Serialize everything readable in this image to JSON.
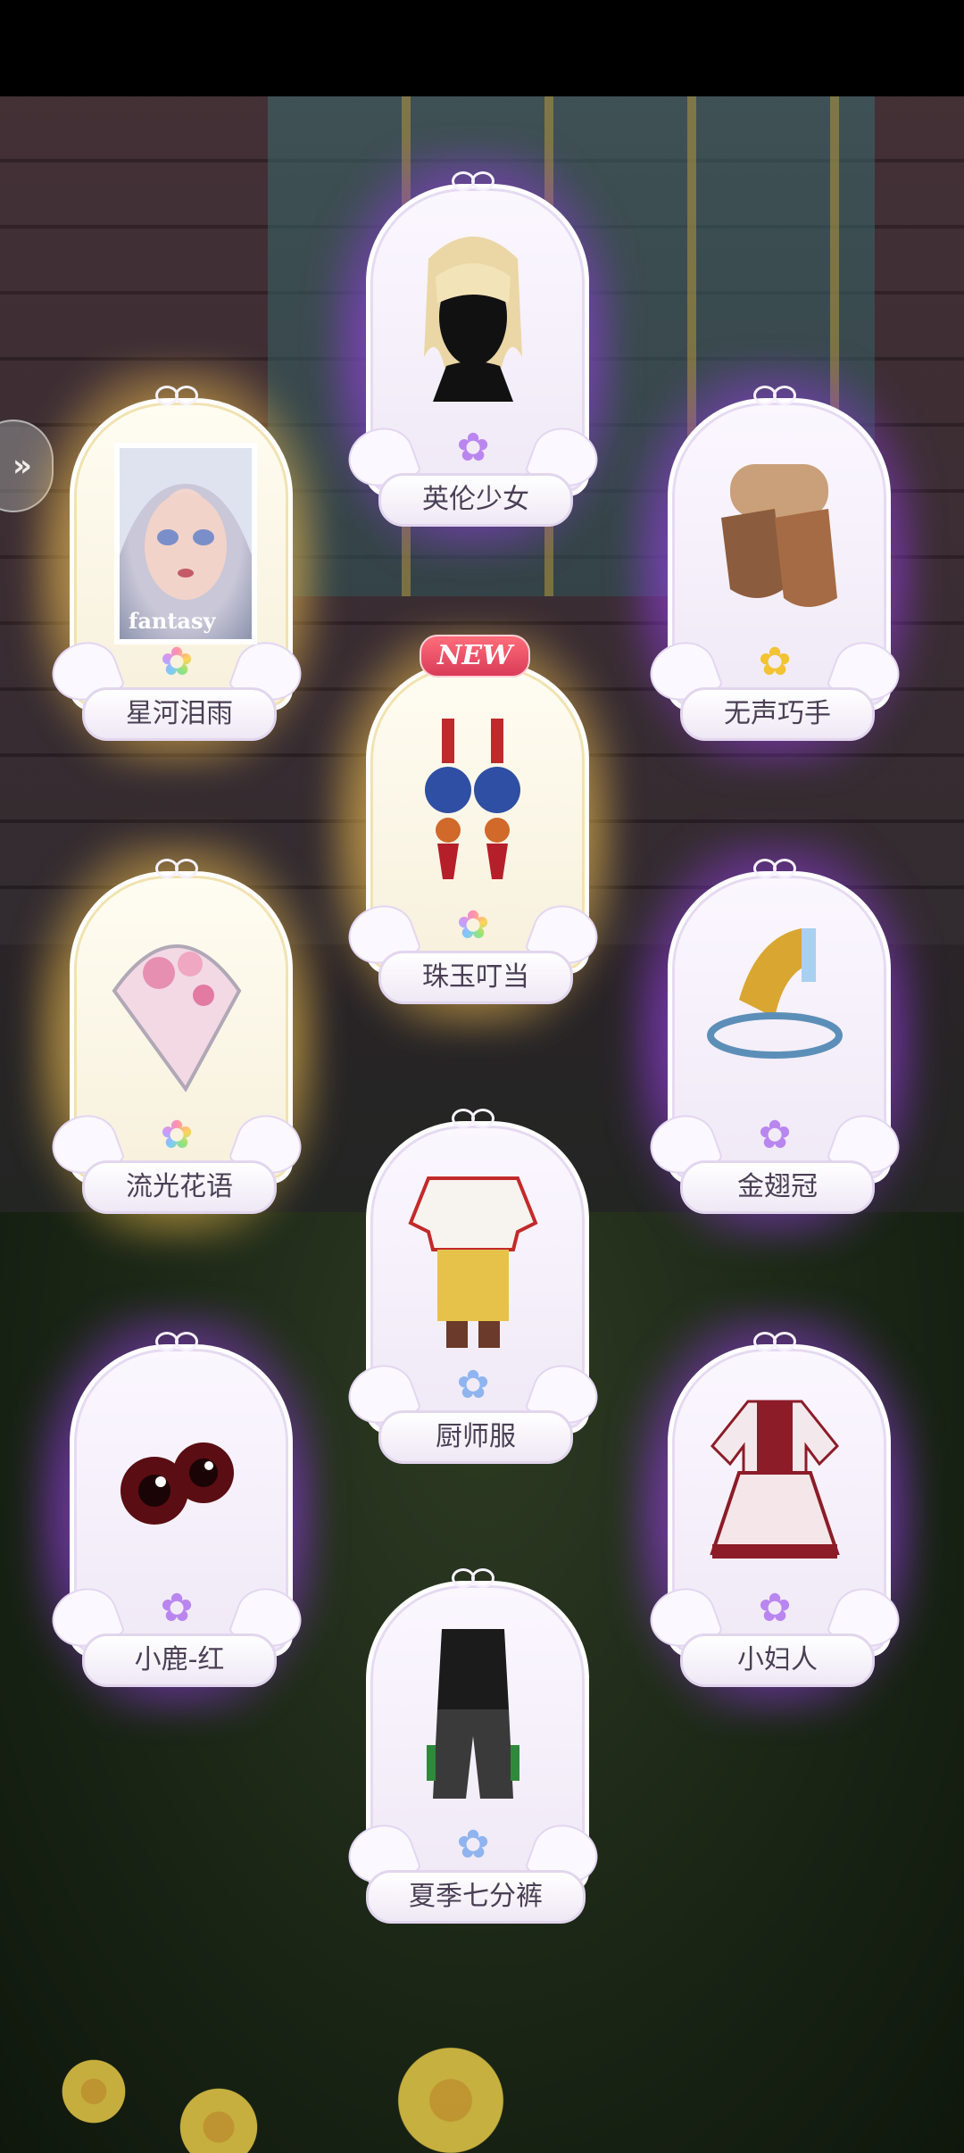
{
  "new_badge": "NEW",
  "photo_caption": "fantasy",
  "items": [
    {
      "id": "yinglun",
      "label": "英伦少女",
      "rarity": "purple",
      "flower": "purple",
      "art": "hair-icon"
    },
    {
      "id": "xinghe",
      "label": "星河泪雨",
      "rarity": "gold",
      "flower": "rainbow",
      "art": "photo"
    },
    {
      "id": "wusheng",
      "label": "无声巧手",
      "rarity": "purple",
      "flower": "gold",
      "art": "gloves-icon"
    },
    {
      "id": "zhuyu",
      "label": "珠玉叮当",
      "rarity": "gold",
      "flower": "rainbow",
      "art": "earrings-icon",
      "new": true
    },
    {
      "id": "liuguang",
      "label": "流光花语",
      "rarity": "gold",
      "flower": "rainbow",
      "art": "fan-icon"
    },
    {
      "id": "jinchi",
      "label": "金翅冠",
      "rarity": "purple",
      "flower": "purple",
      "art": "crown-icon"
    },
    {
      "id": "chushi",
      "label": "厨师服",
      "rarity": "white",
      "flower": "blue",
      "art": "chef-outfit-icon"
    },
    {
      "id": "xiaolu",
      "label": "小鹿-红",
      "rarity": "purple",
      "flower": "purple",
      "art": "eyes-icon"
    },
    {
      "id": "xiaofuren",
      "label": "小妇人",
      "rarity": "purple",
      "flower": "purple",
      "art": "dress-icon"
    },
    {
      "id": "xiaji",
      "label": "夏季七分裤",
      "rarity": "white",
      "flower": "blue",
      "art": "pants-outfit-icon"
    }
  ]
}
